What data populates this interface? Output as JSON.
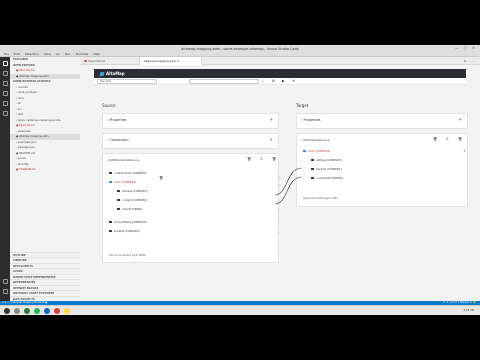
{
  "window": {
    "title": "altamap-mapping.adm - some-example-altamap - Visual Studio Code",
    "controls": "— ▢ ✕"
  },
  "menu": [
    "File",
    "Edit",
    "Selection",
    "View",
    "Go",
    "Run",
    "Terminal",
    "Help"
  ],
  "sidebar": {
    "header": "EXPLORER",
    "rows": [
      {
        "label": "OPEN EDITORS",
        "type": "sec"
      },
      {
        "label": "● Read Me.txt",
        "type": "err"
      },
      {
        "label": "● altamap-mapping.adm",
        "type": "hl"
      },
      {
        "label": "SOME-EXAMPLE-ALTAMAP",
        "type": "sec"
      },
      {
        "label": "› .vscode",
        "type": ""
      },
      {
        "label": "› node_modules",
        "type": ""
      },
      {
        "label": "› docs",
        "type": ""
      },
      {
        "label": "› lib",
        "type": ""
      },
      {
        "label": "› src",
        "type": ""
      },
      {
        "label": "› test",
        "type": ""
      },
      {
        "label": "› types / altamap-mapping-vscode",
        "type": ""
      },
      {
        "label": "● Read Me.txt",
        "type": "err"
      },
      {
        "label": "› examples",
        "type": ""
      },
      {
        "label": "● altamap-mapping.adm",
        "type": "hl"
      },
      {
        "label": "› examples.json",
        "type": ""
      },
      {
        "label": "› package.json",
        "type": ""
      },
      {
        "label": "● README.md",
        "type": ""
      },
      {
        "label": "› server",
        "type": ""
      },
      {
        "label": "› tsconfig",
        "type": ""
      },
      {
        "label": "● CHANGELOG",
        "type": "err"
      }
    ],
    "bottom": [
      "OUTLINE",
      "TIMELINE",
      "NPM SCRIPTS",
      "AZURE",
      "MAVEN MULE DEPENDENCIES",
      "DEPENDENCIES",
      "OPENAPI BLOCKS",
      "ANYPOINT ASSET EXPLORER",
      "JAVA PROJECTS"
    ]
  },
  "tabs": [
    {
      "label": "Read Me.txt",
      "active": false
    },
    {
      "label": "altamap-mapping.adm",
      "active": true
    }
  ],
  "altamap": {
    "brand": "AltaMap",
    "toolbar": {
      "select_value": "Map Data",
      "buttons": [
        "⌕",
        "⚙",
        "▶",
        "⟲"
      ]
    },
    "source": {
      "title": "Source",
      "properties": "Properties",
      "connection": "Connection",
      "schema": "JSONSchemaSource",
      "nodes": [
        {
          "label": "collectionList [COMPLEX]",
          "indent": 0,
          "icon": "dark",
          "sel": false
        },
        {
          "label": "order [COMPLEX]",
          "indent": 0,
          "icon": "blue",
          "sel": true
        },
        {
          "label": "address [COMPLEX]",
          "indent": 1,
          "icon": "dark",
          "sel": false
        },
        {
          "label": "contact [COMPLEX]",
          "indent": 1,
          "icon": "dark",
          "sel": false
        },
        {
          "label": "orderId [TRING]",
          "indent": 1,
          "icon": "dark",
          "sel": false
        },
        {
          "label": "productItems [COMPLEX]",
          "indent": 0,
          "icon": "dark",
          "sel": false
        },
        {
          "label": "pricelist [COMPLEX]",
          "indent": 0,
          "icon": "dark",
          "sel": false
        }
      ],
      "footer": "Source document type: JSON"
    },
    "target": {
      "title": "Target",
      "properties": "Properties",
      "schema": "XSSchemaSource",
      "nodes": [
        {
          "label": "order [COMPLEX]",
          "indent": 0,
          "icon": "blue",
          "sel": true
        },
        {
          "label": "Address [COMPLEX]",
          "indent": 1,
          "icon": "dark",
          "sel": false
        },
        {
          "label": "Contact [COMPLEX]",
          "indent": 1,
          "icon": "dark",
          "sel": false
        },
        {
          "label": "+contactId [STRING]",
          "indent": 1,
          "icon": "dark",
          "sel": false
        }
      ],
      "footer": "Target document type: XML"
    }
  },
  "statusbar": {
    "left": "⊗ 0 ⚠ 0  altamap-mapping  Mulesoft  ●",
    "right": "Ln 1, Col 1  LF  Mapper  ☺  🔔"
  },
  "taskbar": {
    "clock": "4:02 PM"
  },
  "colors": {
    "accent": "#007acc",
    "header_dark": "#2b2f33",
    "selection_red": "#c0392b"
  }
}
